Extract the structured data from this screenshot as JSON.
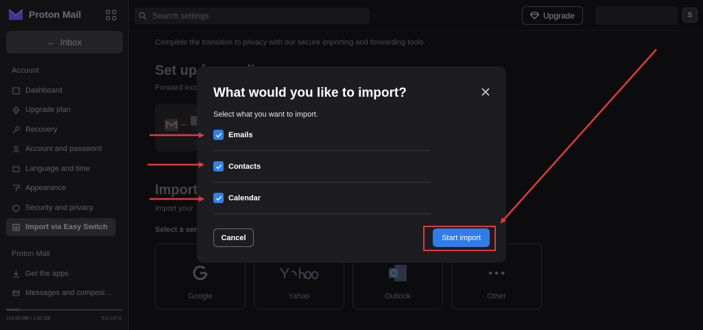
{
  "app": {
    "name": "Proton Mail"
  },
  "sidebar": {
    "inbox_label": "Inbox",
    "account_section": "Account",
    "items": [
      {
        "label": "Dashboard",
        "icon": "dashboard-icon"
      },
      {
        "label": "Upgrade plan",
        "icon": "upgrade-icon"
      },
      {
        "label": "Recovery",
        "icon": "key-icon"
      },
      {
        "label": "Account and password",
        "icon": "user-icon"
      },
      {
        "label": "Language and time",
        "icon": "language-icon"
      },
      {
        "label": "Appearance",
        "icon": "paint-icon"
      },
      {
        "label": "Security and privacy",
        "icon": "shield-icon"
      },
      {
        "label": "Import via Easy Switch",
        "icon": "import-icon",
        "active": true
      }
    ],
    "mail_section": "Proton Mail",
    "mail_items": [
      {
        "label": "Get the apps",
        "icon": "download-icon"
      },
      {
        "label": "Messages and composi…",
        "icon": "envelope-icon"
      }
    ],
    "storage": {
      "text": "114.60 MB / 1.00 GB",
      "version": "5.0.147.0",
      "fraction": 0.11
    }
  },
  "header": {
    "search_placeholder": "Search settings",
    "upgrade_label": "Upgrade",
    "avatar_initial": "S"
  },
  "main": {
    "intro": "Complete the transition to privacy with our secure importing and forwarding tools.",
    "setup_title": "Set up forwarding",
    "setup_desc": "Forward inco",
    "import_title": "Import",
    "import_desc": "Import your",
    "select_service": "Select a serv",
    "services": [
      {
        "name": "Google"
      },
      {
        "name": "Yahoo"
      },
      {
        "name": "Outlook"
      },
      {
        "name": "Other"
      }
    ]
  },
  "modal": {
    "title": "What would you like to import?",
    "subtitle": "Select what you want to import.",
    "options": [
      {
        "label": "Emails",
        "checked": true
      },
      {
        "label": "Contacts",
        "checked": true
      },
      {
        "label": "Calendar",
        "checked": true
      }
    ],
    "cancel_label": "Cancel",
    "start_label": "Start import"
  },
  "colors": {
    "accent": "#2f80ed",
    "annotation": "#e33b3b"
  }
}
